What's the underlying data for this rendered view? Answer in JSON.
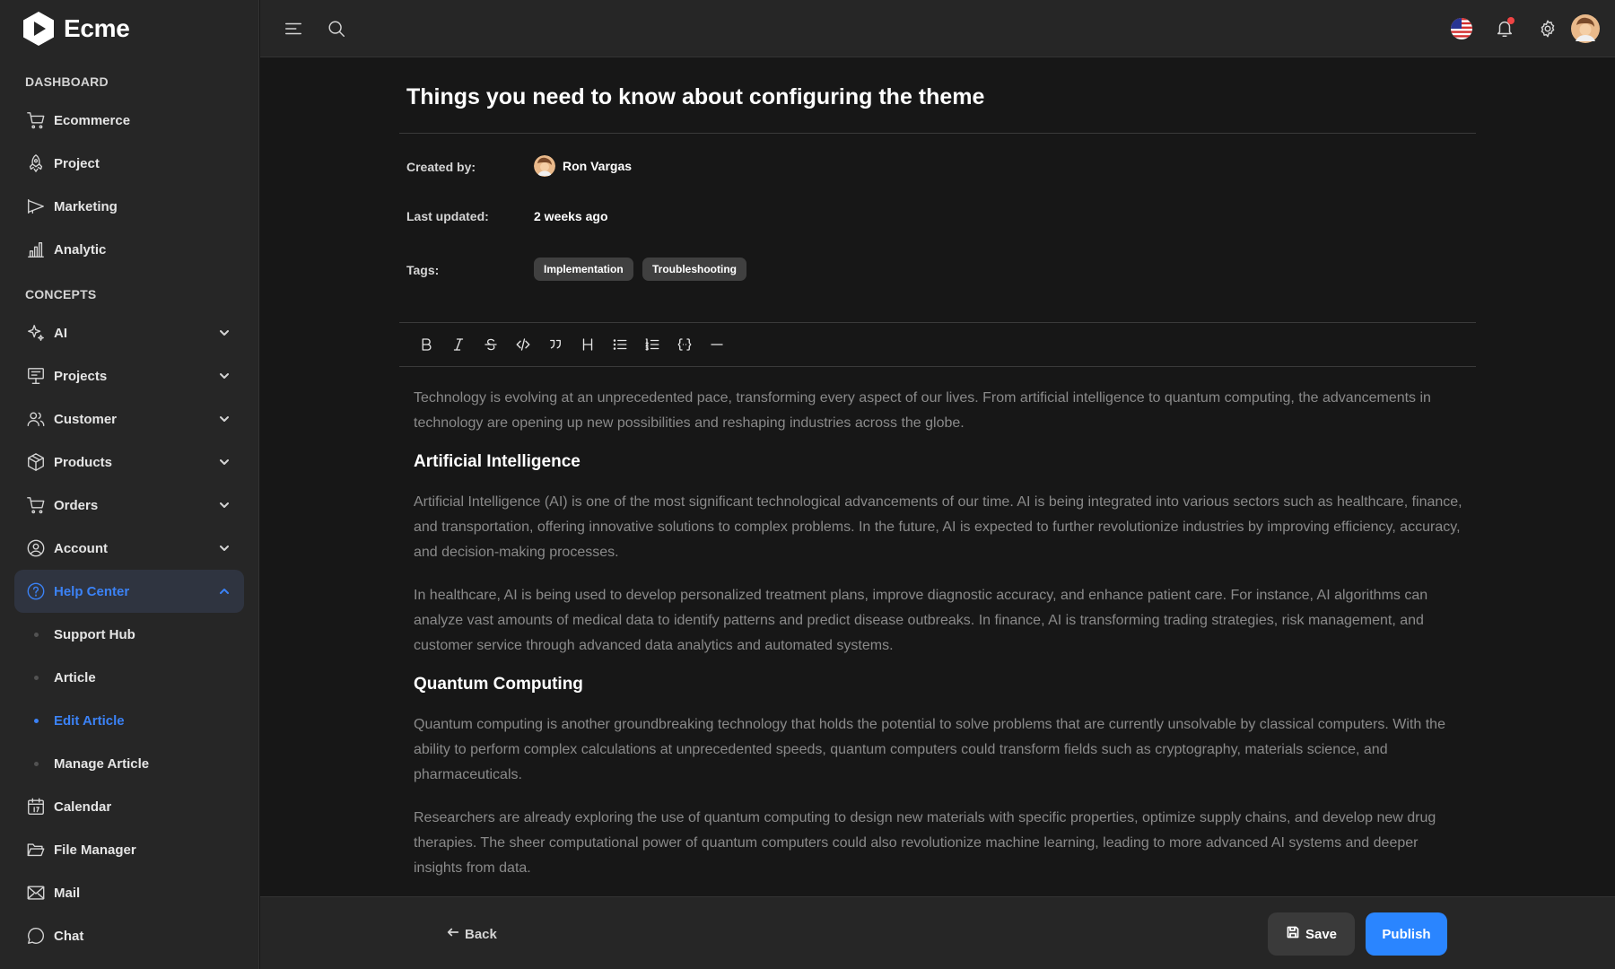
{
  "app": {
    "name": "Ecme"
  },
  "sidebar": {
    "sections": {
      "dashboard": "DASHBOARD",
      "concepts": "CONCEPTS"
    },
    "dashboard_items": [
      {
        "label": "Ecommerce",
        "icon": "cart-icon"
      },
      {
        "label": "Project",
        "icon": "rocket-icon"
      },
      {
        "label": "Marketing",
        "icon": "megaphone-icon"
      },
      {
        "label": "Analytic",
        "icon": "bar-chart-icon"
      }
    ],
    "concept_items": [
      {
        "label": "AI",
        "icon": "sparkle-icon"
      },
      {
        "label": "Projects",
        "icon": "board-icon"
      },
      {
        "label": "Customer",
        "icon": "users-icon"
      },
      {
        "label": "Products",
        "icon": "box-icon"
      },
      {
        "label": "Orders",
        "icon": "cart-icon"
      },
      {
        "label": "Account",
        "icon": "user-circle-icon"
      },
      {
        "label": "Help Center",
        "icon": "help-icon",
        "active": true
      }
    ],
    "help_sub_items": [
      {
        "label": "Support Hub"
      },
      {
        "label": "Article"
      },
      {
        "label": "Edit Article",
        "active": true
      },
      {
        "label": "Manage Article"
      }
    ],
    "bottom_items": [
      {
        "label": "Calendar",
        "icon": "calendar-icon"
      },
      {
        "label": "File Manager",
        "icon": "folder-icon"
      },
      {
        "label": "Mail",
        "icon": "mail-icon"
      },
      {
        "label": "Chat",
        "icon": "chat-icon"
      }
    ]
  },
  "article": {
    "title": "Things you need to know about configuring the theme",
    "created_by_label": "Created by:",
    "author": "Ron Vargas",
    "last_updated_label": "Last updated:",
    "last_updated": "2 weeks ago",
    "tags_label": "Tags:",
    "tags": [
      "Implementation",
      "Troubleshooting"
    ],
    "body": {
      "intro": "Technology is evolving at an unprecedented pace, transforming every aspect of our lives. From artificial intelligence to quantum computing, the advancements in technology are opening up new possibilities and reshaping industries across the globe.",
      "h_ai": "Artificial Intelligence",
      "ai_p1": "Artificial Intelligence (AI) is one of the most significant technological advancements of our time. AI is being integrated into various sectors such as healthcare, finance, and transportation, offering innovative solutions to complex problems. In the future, AI is expected to further revolutionize industries by improving efficiency, accuracy, and decision-making processes.",
      "ai_p2": "In healthcare, AI is being used to develop personalized treatment plans, improve diagnostic accuracy, and enhance patient care. For instance, AI algorithms can analyze vast amounts of medical data to identify patterns and predict disease outbreaks. In finance, AI is transforming trading strategies, risk management, and customer service through advanced data analytics and automated systems.",
      "h_qc": "Quantum Computing",
      "qc_p1": "Quantum computing is another groundbreaking technology that holds the potential to solve problems that are currently unsolvable by classical computers. With the ability to perform complex calculations at unprecedented speeds, quantum computers could transform fields such as cryptography, materials science, and pharmaceuticals.",
      "qc_p2": "Researchers are already exploring the use of quantum computing to design new materials with specific properties, optimize supply chains, and develop new drug therapies. The sheer computational power of quantum computers could also revolutionize machine learning, leading to more advanced AI systems and deeper insights from data."
    }
  },
  "footer": {
    "back": "Back",
    "save": "Save",
    "publish": "Publish"
  },
  "colors": {
    "accent": "#2a85ff",
    "active_text": "#3b82f6",
    "notification": "#ef4444"
  }
}
